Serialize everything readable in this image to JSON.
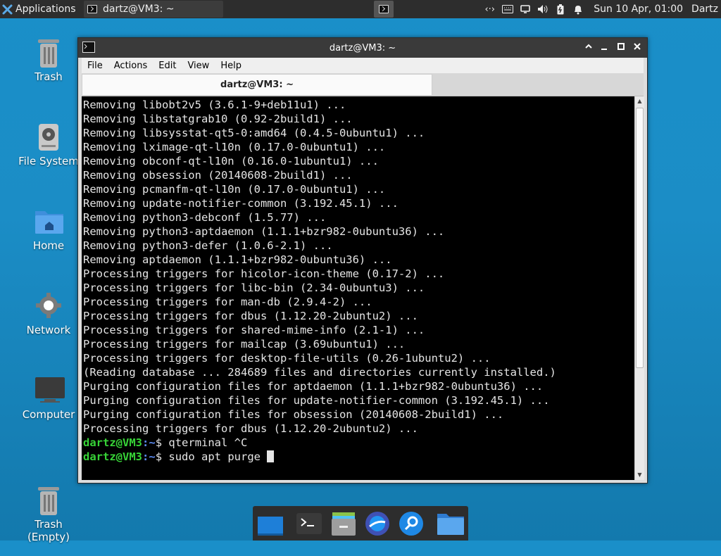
{
  "top_panel": {
    "applications_label": "Applications",
    "task_title": "dartz@VM3: ~",
    "clock": "Sun 10 Apr, 01:00",
    "user": "Dartz",
    "tray_icons": [
      "network-icon",
      "keyboard-icon",
      "display-icon",
      "volume-icon",
      "battery-icon",
      "notification-bell-icon"
    ]
  },
  "desktop_icons": [
    {
      "label": "Trash",
      "icon": "trash-icon"
    },
    {
      "label": "File System",
      "icon": "drive-icon"
    },
    {
      "label": "Home",
      "icon": "home-folder-icon"
    },
    {
      "label": "Network",
      "icon": "network-gear-icon"
    },
    {
      "label": "Computer",
      "icon": "computer-icon"
    },
    {
      "label": "Trash\n(Empty)",
      "icon": "trash-empty-icon"
    }
  ],
  "window": {
    "title": "dartz@VM3: ~",
    "menu": [
      "File",
      "Actions",
      "Edit",
      "View",
      "Help"
    ],
    "tab_label": "dartz@VM3: ~",
    "terminal_lines": [
      "Removing libobt2v5 (3.6.1-9+deb11u1) ...",
      "Removing libstatgrab10 (0.92-2build1) ...",
      "Removing libsysstat-qt5-0:amd64 (0.4.5-0ubuntu1) ...",
      "Removing lximage-qt-l10n (0.17.0-0ubuntu1) ...",
      "Removing obconf-qt-l10n (0.16.0-1ubuntu1) ...",
      "Removing obsession (20140608-2build1) ...",
      "Removing pcmanfm-qt-l10n (0.17.0-0ubuntu1) ...",
      "Removing update-notifier-common (3.192.45.1) ...",
      "Removing python3-debconf (1.5.77) ...",
      "Removing python3-aptdaemon (1.1.1+bzr982-0ubuntu36) ...",
      "Removing python3-defer (1.0.6-2.1) ...",
      "Removing aptdaemon (1.1.1+bzr982-0ubuntu36) ...",
      "Processing triggers for hicolor-icon-theme (0.17-2) ...",
      "Processing triggers for libc-bin (2.34-0ubuntu3) ...",
      "Processing triggers for man-db (2.9.4-2) ...",
      "Processing triggers for dbus (1.12.20-2ubuntu2) ...",
      "Processing triggers for shared-mime-info (2.1-1) ...",
      "Processing triggers for mailcap (3.69ubuntu1) ...",
      "Processing triggers for desktop-file-utils (0.26-1ubuntu2) ...",
      "(Reading database ... 284689 files and directories currently installed.)",
      "Purging configuration files for aptdaemon (1.1.1+bzr982-0ubuntu36) ...",
      "Purging configuration files for update-notifier-common (3.192.45.1) ...",
      "Purging configuration files for obsession (20140608-2build1) ...",
      "Processing triggers for dbus (1.12.20-2ubuntu2) ..."
    ],
    "prompts": [
      {
        "user_host": "dartz@VM3",
        "sep": ":",
        "path": "~",
        "sign": "$",
        "command": " qterminal ^C"
      },
      {
        "user_host": "dartz@VM3",
        "sep": ":",
        "path": "~",
        "sign": "$",
        "command": " sudo apt purge "
      }
    ]
  },
  "dock_items": [
    "workspace-icon",
    "terminal-icon",
    "file-manager-icon",
    "browser-icon",
    "search-icon",
    "folder-icon"
  ],
  "colors": {
    "prompt_user": "#37d337",
    "prompt_path": "#5c8df6",
    "panel": "#2d2d2d"
  }
}
